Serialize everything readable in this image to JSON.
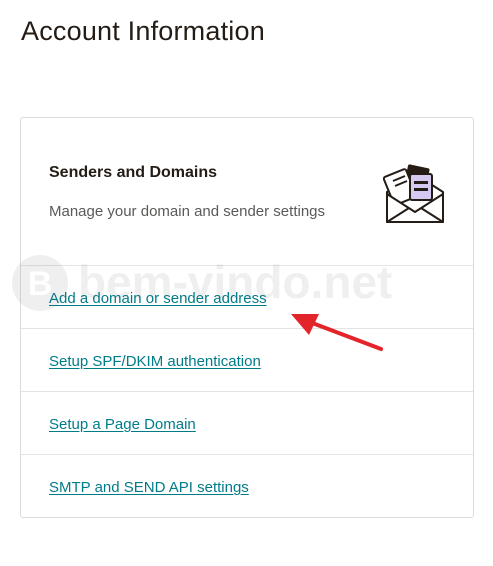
{
  "page": {
    "title": "Account Information"
  },
  "card": {
    "title": "Senders and Domains",
    "description": "Manage your domain and sender settings",
    "icon": "envelope-letter-icon",
    "links": [
      {
        "label": "Add a domain or sender address"
      },
      {
        "label": "Setup SPF/DKIM authentication"
      },
      {
        "label": "Setup a Page Domain"
      },
      {
        "label": "SMTP and SEND API settings"
      }
    ]
  },
  "watermark": {
    "text": "bem-vindo.net"
  },
  "colors": {
    "link": "#007c89",
    "arrow": "#e3242b",
    "icon_accent": "#d5c9f1"
  }
}
